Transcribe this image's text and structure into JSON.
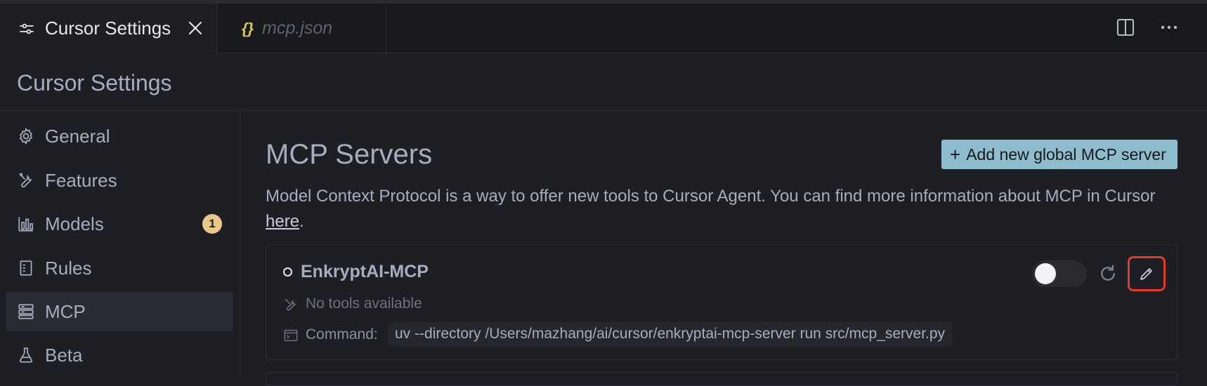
{
  "tabs": [
    {
      "label": "Cursor Settings",
      "icon": "sliders-icon",
      "active": true
    },
    {
      "label": "mcp.json",
      "icon": "json-braces-icon",
      "active": false,
      "glyph": "{}"
    }
  ],
  "settings": {
    "title": "Cursor Settings"
  },
  "sidebar": {
    "items": [
      {
        "label": "General",
        "icon": "gear-icon"
      },
      {
        "label": "Features",
        "icon": "tools-icon"
      },
      {
        "label": "Models",
        "icon": "bar-chart-icon",
        "badge": "1"
      },
      {
        "label": "Rules",
        "icon": "document-icon"
      },
      {
        "label": "MCP",
        "icon": "server-icon",
        "active": true
      },
      {
        "label": "Beta",
        "icon": "flask-icon"
      }
    ]
  },
  "main": {
    "title": "MCP Servers",
    "add_button": {
      "plus": "+",
      "label": "Add new global MCP server"
    },
    "description_text": "Model Context Protocol is a way to offer new tools to Cursor Agent. You can find more information about MCP in Cursor ",
    "description_link": "here",
    "description_end": ".",
    "servers": [
      {
        "name": "EnkryptAI-MCP",
        "enabled": false,
        "tools_text": "No tools available",
        "command_label": "Command:",
        "command": "uv --directory /Users/mazhang/ai/cursor/enkryptai-mcp-server run src/mcp_server.py"
      }
    ]
  },
  "colors": {
    "accent_button": "#8fbccd",
    "badge": "#e8c98a",
    "highlight_border": "#e23a2a"
  }
}
